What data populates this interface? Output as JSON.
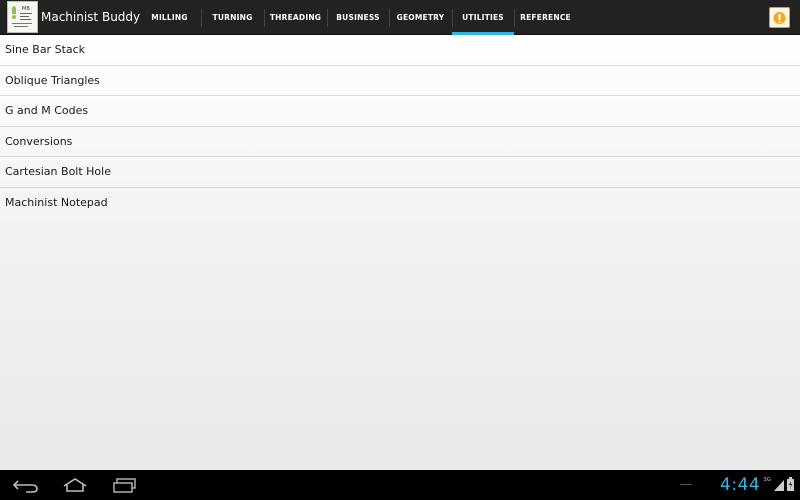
{
  "app": {
    "title": "Machinist Buddy"
  },
  "tabs": [
    {
      "label": "MILLING",
      "selected": false
    },
    {
      "label": "TURNING",
      "selected": false
    },
    {
      "label": "THREADING",
      "selected": false
    },
    {
      "label": "BUSINESS",
      "selected": false
    },
    {
      "label": "GEOMETRY",
      "selected": false
    },
    {
      "label": "UTILITIES",
      "selected": true
    },
    {
      "label": "REFERENCE",
      "selected": false
    }
  ],
  "list": {
    "items": [
      {
        "label": "Sine Bar Stack"
      },
      {
        "label": "Oblique Triangles"
      },
      {
        "label": "G and M Codes"
      },
      {
        "label": "Conversions"
      },
      {
        "label": "Cartesian Bolt Hole"
      },
      {
        "label": "Machinist Notepad"
      }
    ]
  },
  "status": {
    "time": "4:44",
    "network": "3G"
  },
  "colors": {
    "accent": "#33b5e5",
    "action_bar": "#222222",
    "nav_bar": "#000000"
  },
  "icons": {
    "app": "machinist-buddy-app-icon",
    "menu": "overflow-menu-icon",
    "back": "back-icon",
    "home": "home-icon",
    "recents": "recent-apps-icon",
    "signal": "signal-icon",
    "battery": "battery-icon"
  }
}
